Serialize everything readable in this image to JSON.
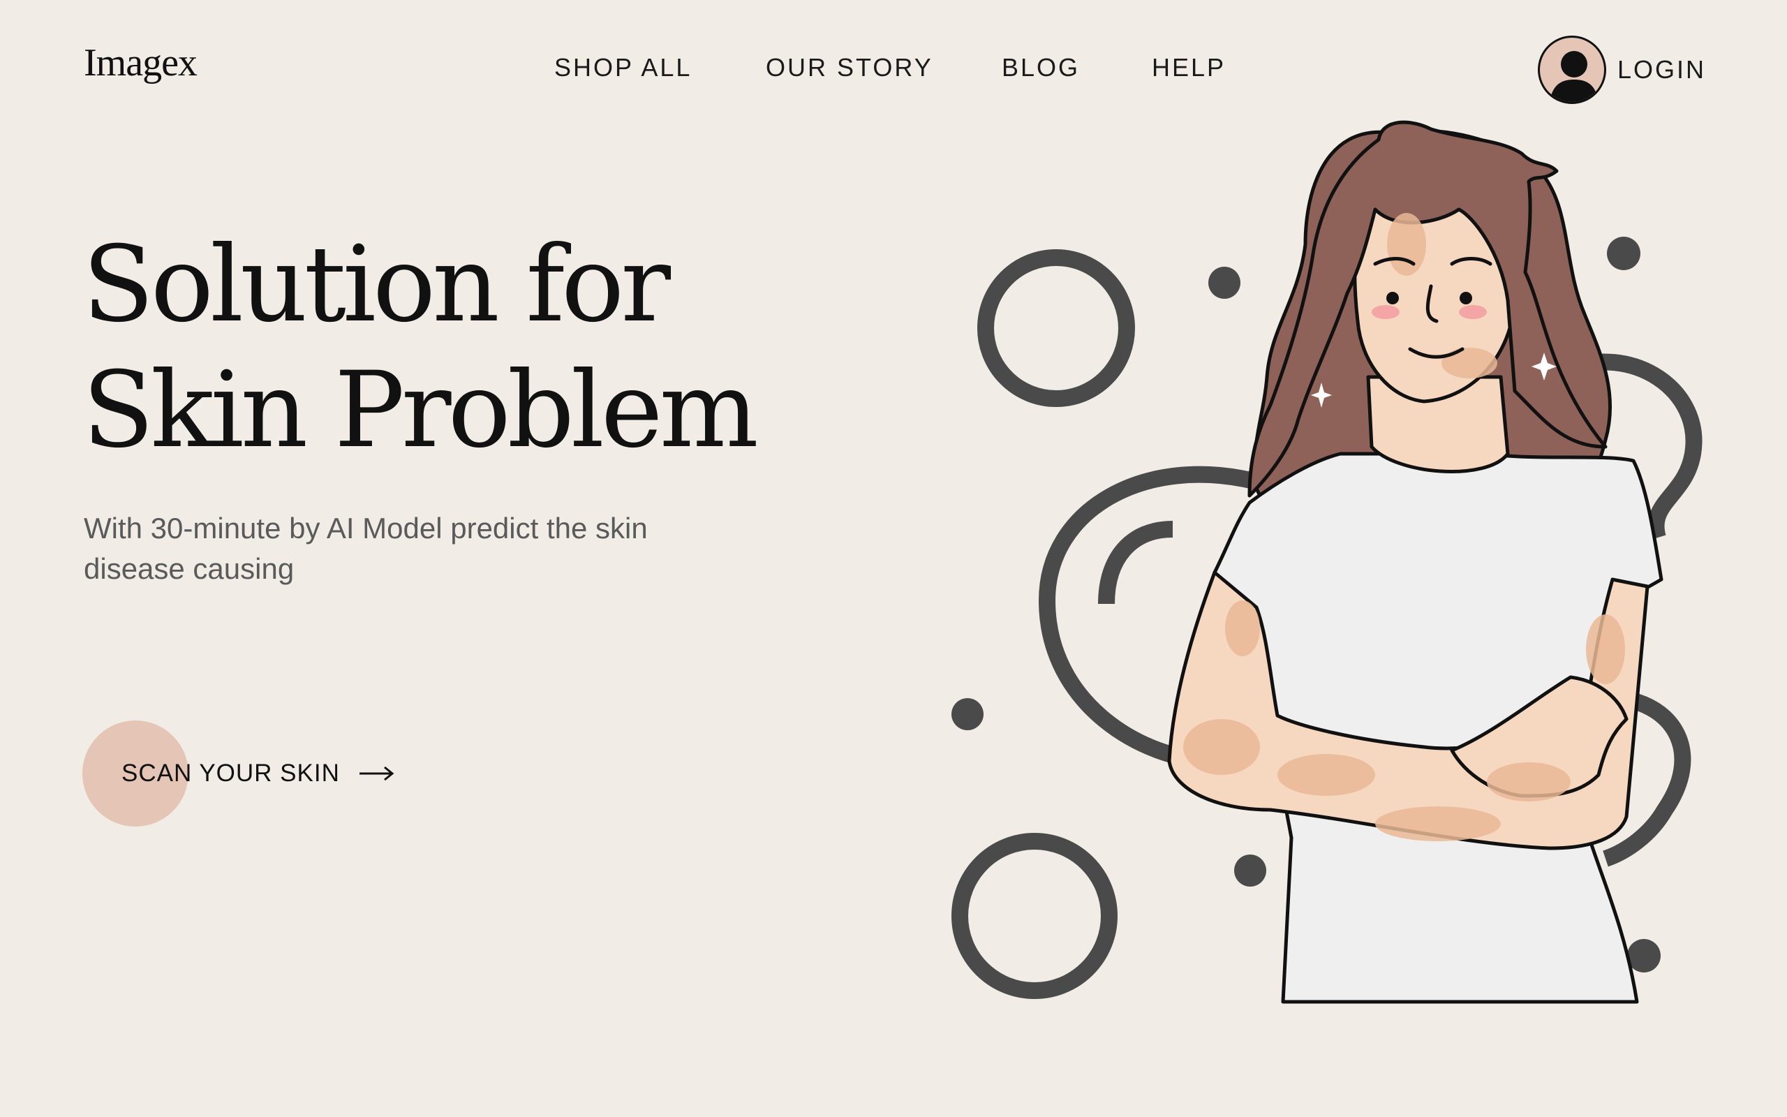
{
  "header": {
    "logo": "Imagex",
    "nav": [
      {
        "label": "SHOP ALL"
      },
      {
        "label": "OUR STORY"
      },
      {
        "label": "BLOG"
      },
      {
        "label": "HELP"
      }
    ],
    "login_label": "LOGIN",
    "login_icon": "user-avatar-icon"
  },
  "hero": {
    "title_line1": "Solution for",
    "title_line2": "Skin Problem",
    "subtitle": "With 30-minute by AI Model predict the skin disease causing",
    "cta_label": "SCAN YOUR SKIN",
    "cta_icon": "arrow-right-icon"
  },
  "colors": {
    "background": "#f1ece6",
    "accent": "#e4c5b6",
    "text": "#111111",
    "subtext": "#5a5a5a",
    "shape": "#4a4a4a",
    "hair": "#8e6259",
    "skin": "#f6d7c0",
    "shirt": "#efefef"
  }
}
